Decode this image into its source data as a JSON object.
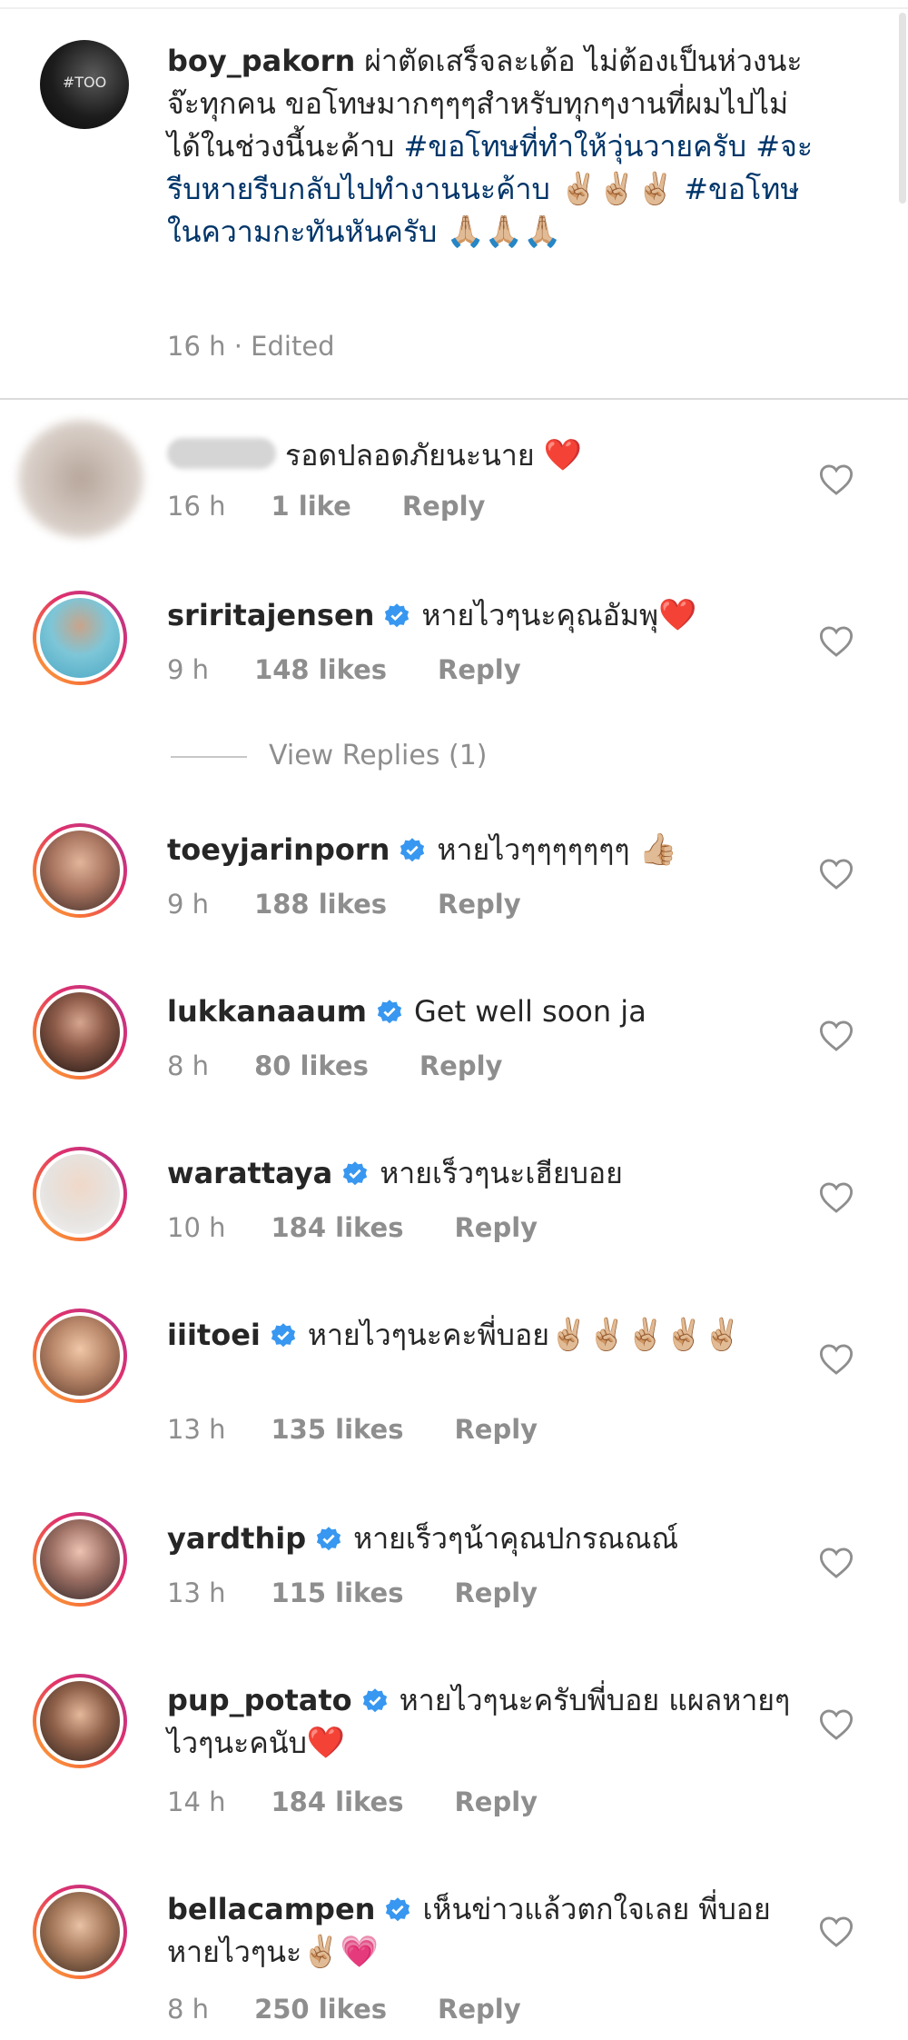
{
  "post": {
    "username": "boy_pakorn",
    "avatar_label": "#TOO",
    "caption": "ผ่าตัดเสร็จละเด้อ ไม่ต้องเป็นห่วงนะจ๊ะทุกคน ขอโทษมากๆๆๆสำหรับทุกๆงานที่ผมไปไม่ได้ในช่วงนี้นะค้าบ ",
    "hashtag1": "#ขอโทษที่ทำให้วุ่นวายครับ",
    "hashtag2": "#จะรีบหายรีบกลับไปทำงานนะค้าบ",
    "emojis1": "✌🏼✌🏼✌🏼",
    "hashtag3": "#ขอโทษในความกะทันหันครับ",
    "emojis2": "🙏🏼🙏🏼🙏🏼",
    "time": "16 h",
    "edited": "Edited"
  },
  "comments": [
    {
      "username": "",
      "text": "รอดปลอดภัยนะนาย ",
      "emoji": "❤️",
      "time": "16 h",
      "likes": "1 like",
      "reply": "Reply"
    },
    {
      "username": "sriritajensen",
      "text": "หายไวๆนะคุณอัมพุ",
      "emoji": "❤️",
      "time": "9 h",
      "likes": "148 likes",
      "reply": "Reply"
    },
    {
      "username": "toeyjarinporn",
      "text": "หายไวๆๆๆๆๆๆๆ ",
      "emoji": "👍🏼",
      "time": "9 h",
      "likes": "188 likes",
      "reply": "Reply"
    },
    {
      "username": "lukkanaaum",
      "text": "Get well soon ja",
      "emoji": "",
      "time": "8 h",
      "likes": "80 likes",
      "reply": "Reply"
    },
    {
      "username": "warattaya",
      "text": "หายเร็วๆนะเฮียบอย",
      "emoji": "",
      "time": "10 h",
      "likes": "184 likes",
      "reply": "Reply"
    },
    {
      "username": "iiitoei",
      "text": "หายไวๆนะคะพี่บอย",
      "emoji": "✌🏼✌🏼✌🏼✌🏼✌🏼",
      "time": "13 h",
      "likes": "135 likes",
      "reply": "Reply"
    },
    {
      "username": "yardthip",
      "text": "หายเร็วๆน้าคุณปกรณณณ์",
      "emoji": "",
      "time": "13 h",
      "likes": "115 likes",
      "reply": "Reply"
    },
    {
      "username": "pup_potato",
      "text": "หายไวๆนะครับพี่บอย แผลหายๆไวๆนะคนับ",
      "emoji": "❤️",
      "time": "14 h",
      "likes": "184 likes",
      "reply": "Reply"
    },
    {
      "username": "bellacampen",
      "text": "เห็นข่าวแล้วตกใจเลย พี่บอยหายไวๆนะ",
      "emoji": "✌🏼💗",
      "time": "8 h",
      "likes": "250 likes",
      "reply": "Reply"
    }
  ],
  "view_replies": "View Replies (1)",
  "colors": {
    "accent": "#003569",
    "muted": "#8e8e8e",
    "verified": "#3897f0"
  }
}
